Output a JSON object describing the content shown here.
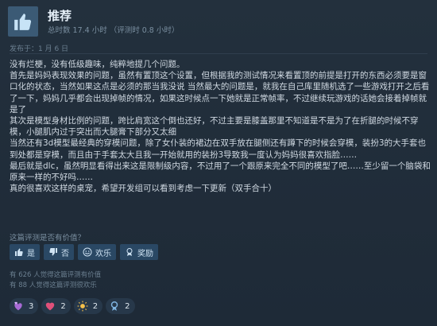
{
  "review": {
    "title": "推荐",
    "hours": "总时数 17.4 小时 （评测时 0.8 小时）",
    "posted": "发布于：1 月 6 日",
    "body_lines": [
      "没有烂梗，没有低级趣味，纯粹地提几个问题。",
      "首先是妈妈表现效果的问题，虽然有置顶这个设置，但根据我的测试情况来看置顶的前提是打开的东西必须要是窗口化的状态，当然如果这点是必须的那当我没说 当然最大的问题是，就我在自己库里随机选了一些游戏打开之后看了一下，妈妈几乎都会出现掉帧的情况，如果这时候点一下她就是正常帧率，不过继续玩游戏的话她会接着掉帧就是了",
      "其次是模型身材比例的问题，跨比肩宽这个倒也还好，不过主要是膝盖那里不知道是不是为了在折腿的时候不穿模，小腿肌内过于突出而大腿膏下部分又太细",
      "当然还有3d模型最经典的穿模问题，除了女仆装的裙边在双手放在腿侧还有蹲下的时候会穿模，装扮3的大手套也到处都是穿模，而且由于手套太大且我一开始就用的装扮3导致我一度认为妈妈很喜欢指脸……",
      "最后就是dlc，虽然明显看得出来这是限制级内容，不过用了一个跟原来完全不同的模型了吧……至少留一个脑袋和原来一样的不好吗……",
      "真的很喜欢这样的桌宠，希望开发组可以看到考虑一下更新（双手合十）"
    ]
  },
  "helpful": {
    "question": "这篇评测是否有价值？",
    "yes": "是",
    "no": "否",
    "funny": "欢乐",
    "award": "奖励"
  },
  "stats": {
    "helpful_count": "有 626 人觉得这篇评测有价值",
    "funny_count": "有 88 人觉得这篇评测很欢乐"
  },
  "awards": [
    {
      "icon": "hearts-award-icon",
      "count": "3"
    },
    {
      "icon": "heart-award-icon",
      "count": "2"
    },
    {
      "icon": "sun-award-icon",
      "count": "2"
    },
    {
      "icon": "ribbon-award-icon",
      "count": "2"
    }
  ],
  "colors": {
    "background": "#1b2838",
    "button": "#2a4864",
    "accent": "#66c0f4"
  }
}
